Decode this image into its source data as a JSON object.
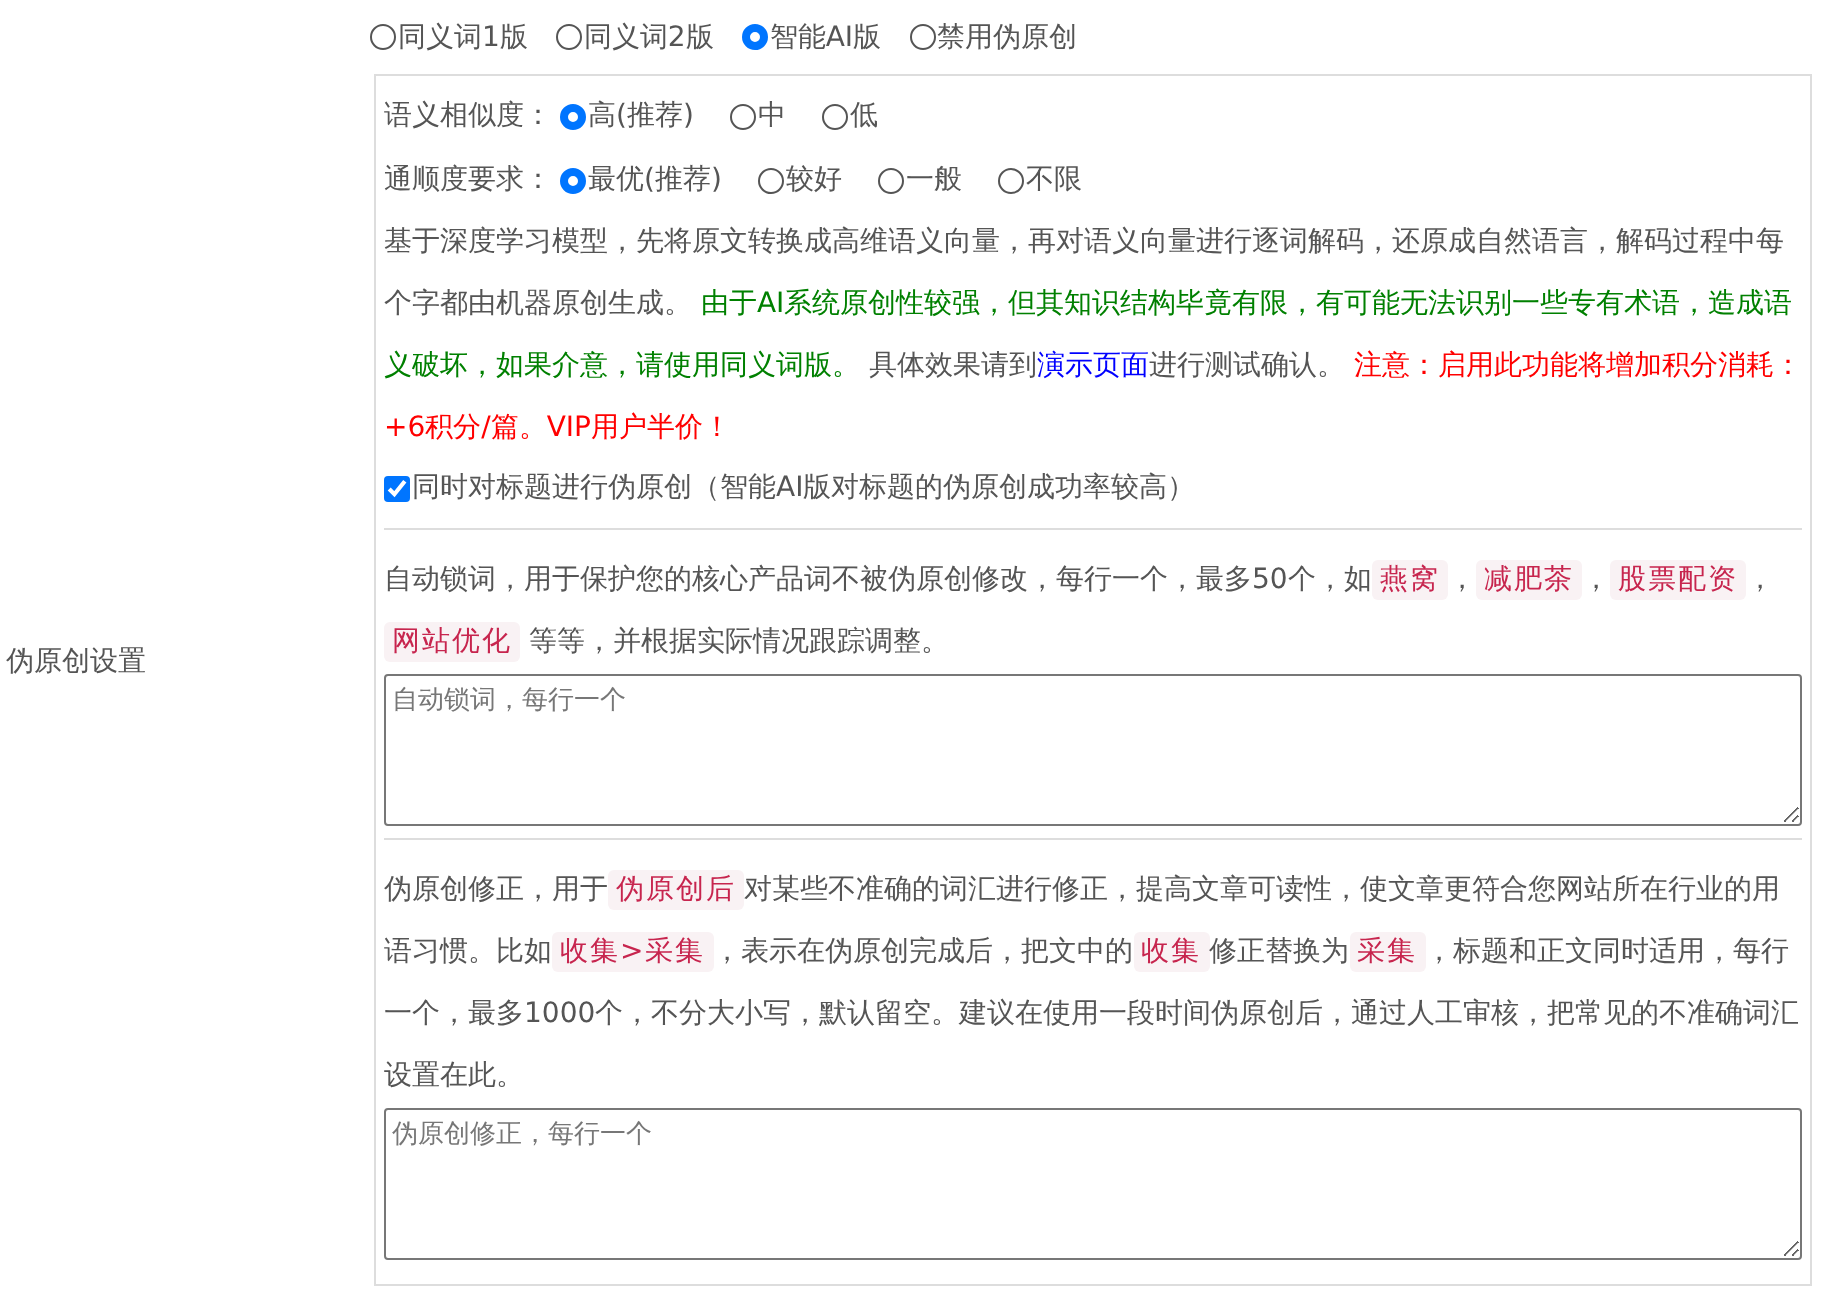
{
  "sidebar_label": "伪原创设置",
  "modes": [
    {
      "label": "同义词1版",
      "selected": false
    },
    {
      "label": "同义词2版",
      "selected": false
    },
    {
      "label": "智能AI版",
      "selected": true
    },
    {
      "label": "禁用伪原创",
      "selected": false
    }
  ],
  "similarity": {
    "label": "语义相似度：",
    "options": [
      {
        "label": "高(推荐)",
        "selected": true
      },
      {
        "label": "中",
        "selected": false
      },
      {
        "label": "低",
        "selected": false
      }
    ]
  },
  "fluency": {
    "label": "通顺度要求：",
    "options": [
      {
        "label": "最优(推荐)",
        "selected": true
      },
      {
        "label": "较好",
        "selected": false
      },
      {
        "label": "一般",
        "selected": false
      },
      {
        "label": "不限",
        "selected": false
      }
    ]
  },
  "ai_description": [
    {
      "kind": "plain",
      "text": "基于深度学习模型，先将原文转换成高维语义向量，再对语义向量进行逐词解码，还原成自然语言，解码过程中每个字都由机器原创生成。 "
    },
    {
      "kind": "green",
      "text": "由于AI系统原创性较强，但其知识结构毕竟有限，有可能无法识别一些专有术语，造成语义破坏，如果介意，请使用同义词版。"
    },
    {
      "kind": "plain",
      "text": " 具体效果请到"
    },
    {
      "kind": "link",
      "text": "演示页面"
    },
    {
      "kind": "plain",
      "text": "进行测试确认。 "
    },
    {
      "kind": "red",
      "text": "注意：启用此功能将增加积分消耗：+6积分/篇。VIP用户半价！"
    }
  ],
  "title_option": {
    "label": "同时对标题进行伪原创（智能AI版对标题的伪原创成功率较高）",
    "checked": true
  },
  "lock_words": {
    "description": [
      {
        "kind": "plain",
        "text": "自动锁词，用于保护您的核心产品词不被伪原创修改，每行一个，最多50个，如"
      },
      {
        "kind": "tag",
        "text": "燕窝"
      },
      {
        "kind": "plain",
        "text": "，"
      },
      {
        "kind": "tag",
        "text": "减肥茶"
      },
      {
        "kind": "plain",
        "text": "，"
      },
      {
        "kind": "tag",
        "text": "股票配资"
      },
      {
        "kind": "plain",
        "text": "，"
      },
      {
        "kind": "tag",
        "text": "网站优化"
      },
      {
        "kind": "plain",
        "text": " 等等，并根据实际情况跟踪调整。"
      }
    ],
    "placeholder": "自动锁词，每行一个"
  },
  "corrections": {
    "description": [
      {
        "kind": "plain",
        "text": "伪原创修正，用于"
      },
      {
        "kind": "tag",
        "text": "伪原创后"
      },
      {
        "kind": "plain",
        "text": "对某些不准确的词汇进行修正，提高文章可读性，使文章更符合您网站所在行业的用语习惯。比如"
      },
      {
        "kind": "tag",
        "text": "收集>采集"
      },
      {
        "kind": "plain",
        "text": "，表示在伪原创完成后，把文中的"
      },
      {
        "kind": "tag",
        "text": "收集"
      },
      {
        "kind": "plain",
        "text": "修正替换为"
      },
      {
        "kind": "tag",
        "text": "采集"
      },
      {
        "kind": "plain",
        "text": "，标题和正文同时适用，每行一个，最多1000个，不分大小写，默认留空。建议在使用一段时间伪原创后，通过人工审核，把常见的不准确词汇设置在此。"
      }
    ],
    "placeholder": "伪原创修正，每行一个"
  }
}
